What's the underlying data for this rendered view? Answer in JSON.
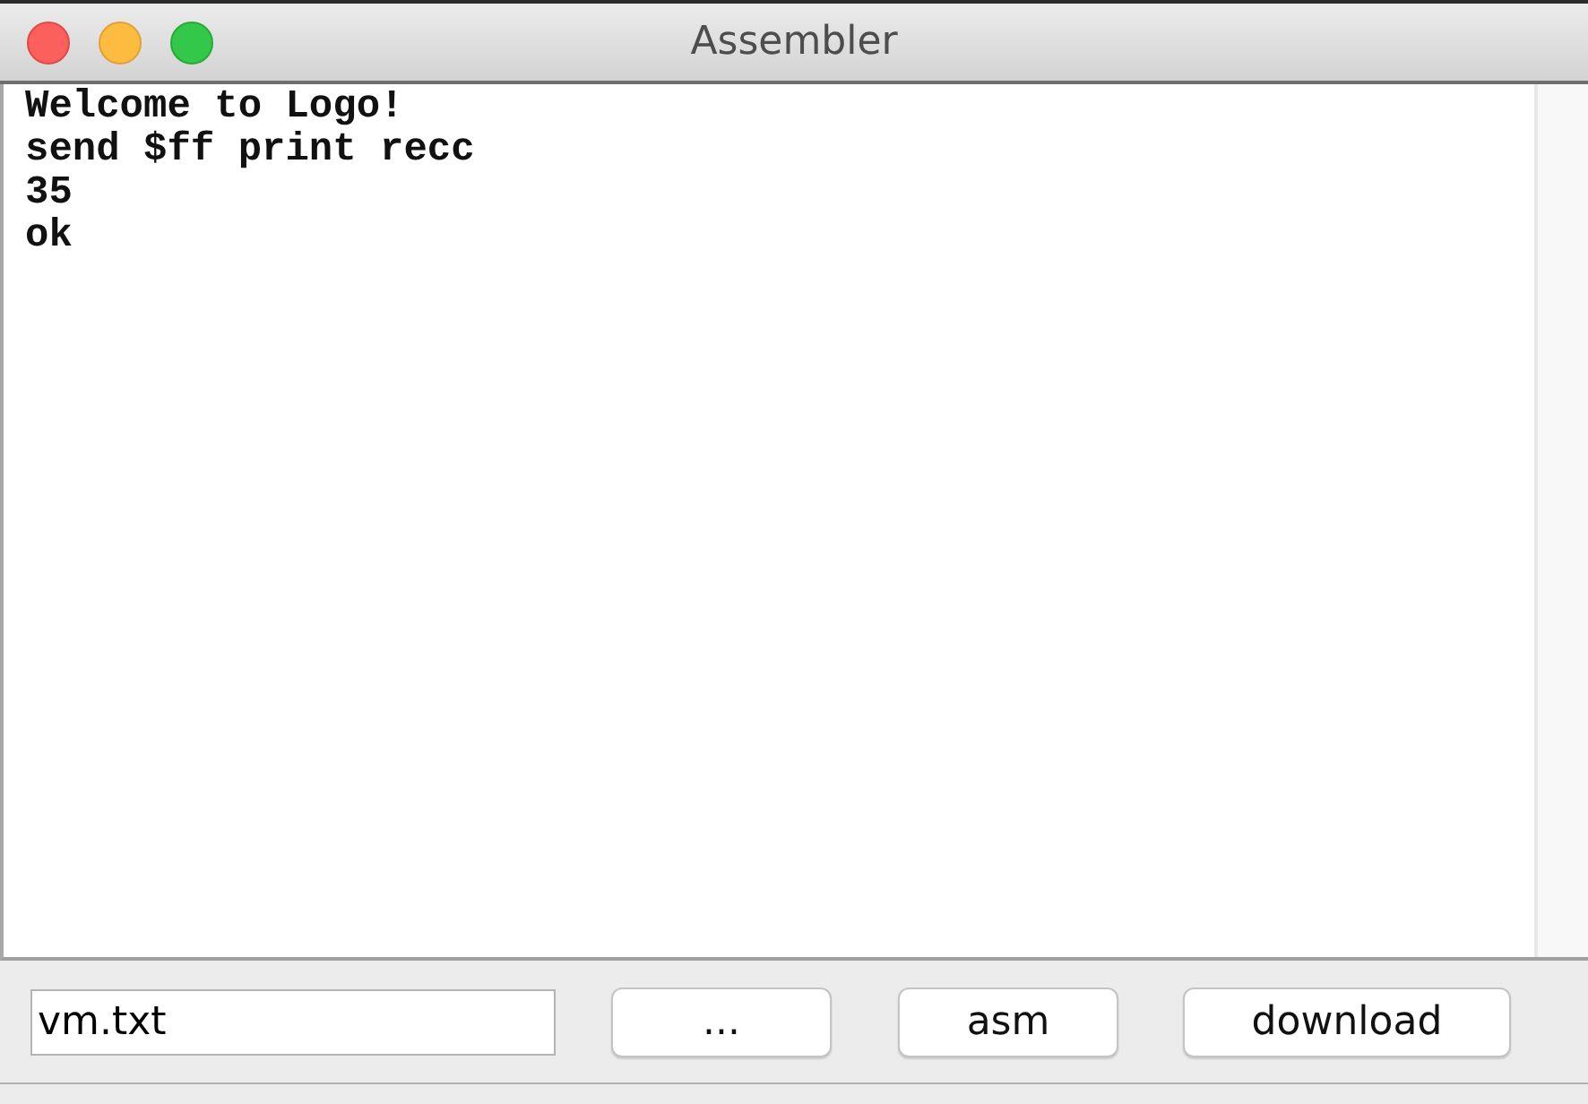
{
  "window": {
    "title": "Assembler"
  },
  "console": {
    "lines": [
      "Welcome to Logo!",
      "send $ff print recc",
      "35",
      "ok"
    ]
  },
  "file_field": {
    "value": "vm.txt"
  },
  "buttons": [
    "...",
    "asm",
    "download"
  ]
}
